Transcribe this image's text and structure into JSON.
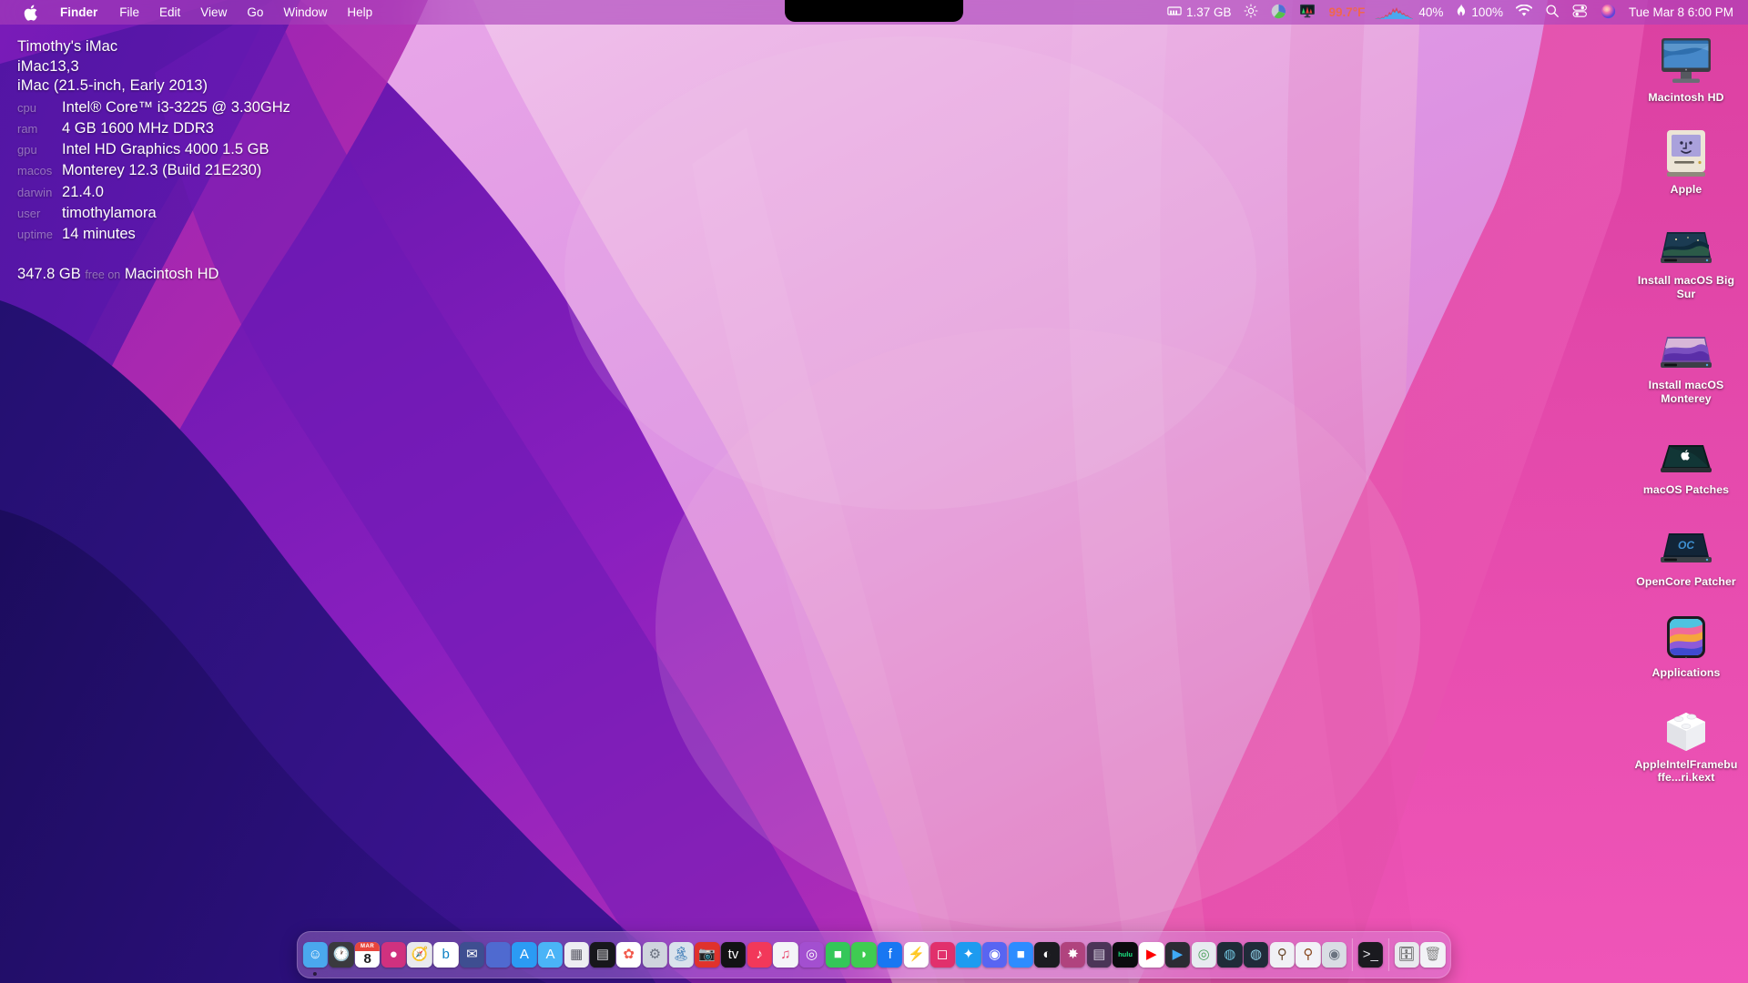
{
  "menubar": {
    "apple_icon": "apple-logo-icon",
    "items": [
      {
        "label": "Finder",
        "bold": true
      },
      {
        "label": "File",
        "bold": false
      },
      {
        "label": "Edit",
        "bold": false
      },
      {
        "label": "View",
        "bold": false
      },
      {
        "label": "Go",
        "bold": false
      },
      {
        "label": "Window",
        "bold": false
      },
      {
        "label": "Help",
        "bold": false
      }
    ],
    "status": {
      "memory_icon": "memory-chip-icon",
      "memory_value": "1.37 GB",
      "brightness_icon": "brightness-sun-icon",
      "disk_pie_icon": "disk-usage-pie-icon",
      "monitor_icon": "display-monitor-icon",
      "temperature_value": "99.7°F",
      "temperature_color": "#f0664f",
      "cpu_graph_icon": "cpu-history-graph-icon",
      "cpu_value": "40%",
      "fan_icon": "fan-flame-icon",
      "fan_value": "100%",
      "wifi_icon": "wifi-icon",
      "search_icon": "spotlight-search-icon",
      "control_center_icon": "control-center-icon",
      "siri_icon": "siri-icon",
      "clock": "Tue Mar 8  6:00 PM"
    }
  },
  "sysinfo": {
    "machine_name": "Timothy's iMac",
    "model_id": "iMac13,3",
    "model_name": "iMac (21.5-inch, Early 2013)",
    "rows": [
      {
        "key": "cpu",
        "value": "Intel® Core™ i3-3225 @ 3.30GHz"
      },
      {
        "key": "ram",
        "value": "4 GB 1600 MHz DDR3"
      },
      {
        "key": "gpu",
        "value": "Intel HD Graphics 4000 1.5 GB"
      },
      {
        "key": "macos",
        "value": "Monterey 12.3 (Build 21E230)"
      },
      {
        "key": "darwin",
        "value": "21.4.0"
      },
      {
        "key": "user",
        "value": "timothylamora"
      },
      {
        "key": "uptime",
        "value": "14 minutes"
      }
    ],
    "disk_free": "347.8 GB",
    "disk_mid": "free on",
    "disk_volume": "Macintosh HD"
  },
  "desktop_icons": [
    {
      "label": "Macintosh HD",
      "icon": "imac-drive-icon"
    },
    {
      "label": "Apple",
      "icon": "classic-mac-folder-icon"
    },
    {
      "label": "Install macOS Big Sur",
      "icon": "bigsur-installer-disk-icon"
    },
    {
      "label": "Install macOS Monterey",
      "icon": "monterey-installer-disk-icon"
    },
    {
      "label": "macOS Patches",
      "icon": "apple-dark-disk-icon"
    },
    {
      "label": "OpenCore Patcher",
      "icon": "opencore-disk-icon"
    },
    {
      "label": "Applications",
      "icon": "applications-folder-icon"
    },
    {
      "label": "AppleIntelFramebuffe...ri.kext",
      "icon": "kext-brick-icon"
    }
  ],
  "dock": {
    "left": [
      {
        "name": "finder",
        "glyph": "☺",
        "bg": "#4aa8ee",
        "fg": "#ffffff",
        "running": true
      },
      {
        "name": "clock",
        "glyph": "🕐",
        "bg": "#3a3a3e",
        "fg": "#ffffff",
        "running": false
      },
      {
        "name": "calendar",
        "glyph": "8",
        "bg": "#ffffff",
        "fg": "#1d1d1f",
        "running": false,
        "badge": "MAR"
      },
      {
        "name": "siri",
        "glyph": "●",
        "bg": "#d0317f",
        "fg": "#ffffff",
        "running": false
      },
      {
        "name": "safari",
        "glyph": "🧭",
        "bg": "#e9e9ee",
        "fg": "#2d6fd6",
        "running": false
      },
      {
        "name": "bing",
        "glyph": "b",
        "bg": "#ffffff",
        "fg": "#0c80c4",
        "running": false
      },
      {
        "name": "mail",
        "glyph": "✉",
        "bg": "#3e4e91",
        "fg": "#ffffff",
        "running": false
      },
      {
        "name": "apple-music-app",
        "glyph": "",
        "bg": "#4f6ad0",
        "fg": "#ffffff",
        "running": false
      },
      {
        "name": "app-store",
        "glyph": "A",
        "bg": "#2b9bf4",
        "fg": "#ffffff",
        "running": false
      },
      {
        "name": "app-store-alt",
        "glyph": "A",
        "bg": "#4ab4f7",
        "fg": "#ffffff",
        "running": false
      },
      {
        "name": "launchpad",
        "glyph": "▦",
        "bg": "#ededf2",
        "fg": "#5a5a66",
        "running": false
      },
      {
        "name": "mission-control",
        "glyph": "▤",
        "bg": "#17171c",
        "fg": "#d8d8dd",
        "running": false
      },
      {
        "name": "photos",
        "glyph": "✿",
        "bg": "#ffffff",
        "fg": "#f25a4c",
        "running": false
      },
      {
        "name": "system-prefs",
        "glyph": "⚙",
        "bg": "#cfd4dd",
        "fg": "#6b7280",
        "running": false
      },
      {
        "name": "preview",
        "glyph": "🏝",
        "bg": "#d9e2ec",
        "fg": "#2a6fb0",
        "running": false
      },
      {
        "name": "photo-booth",
        "glyph": "📷",
        "bg": "#e0322c",
        "fg": "#ffffff",
        "running": false
      },
      {
        "name": "apple-tv",
        "glyph": "tv",
        "bg": "#121214",
        "fg": "#ffffff",
        "running": false
      },
      {
        "name": "music",
        "glyph": "♪",
        "bg": "#f2385a",
        "fg": "#ffffff",
        "running": false
      },
      {
        "name": "itunes",
        "glyph": "♫",
        "bg": "#f4f4f8",
        "fg": "#e8436a",
        "running": false
      },
      {
        "name": "podcasts",
        "glyph": "◎",
        "bg": "#a34fd0",
        "fg": "#ffffff",
        "running": false
      },
      {
        "name": "facetime",
        "glyph": "■",
        "bg": "#34c759",
        "fg": "#ffffff",
        "running": false
      },
      {
        "name": "messages",
        "glyph": "◗",
        "bg": "#3fcc52",
        "fg": "#ffffff",
        "running": false
      },
      {
        "name": "facebook",
        "glyph": "f",
        "bg": "#1877f2",
        "fg": "#ffffff",
        "running": false
      },
      {
        "name": "messenger",
        "glyph": "⚡",
        "bg": "#ffffff",
        "fg": "#1a7af8",
        "running": false
      },
      {
        "name": "instagram",
        "glyph": "◻",
        "bg": "#e1306c",
        "fg": "#ffffff",
        "running": false
      },
      {
        "name": "twitter",
        "glyph": "✦",
        "bg": "#1d9bf0",
        "fg": "#ffffff",
        "running": false
      },
      {
        "name": "discord",
        "glyph": "◉",
        "bg": "#5865f2",
        "fg": "#ffffff",
        "running": false
      },
      {
        "name": "zoom",
        "glyph": "■",
        "bg": "#2d8cff",
        "fg": "#ffffff",
        "running": false
      },
      {
        "name": "github",
        "glyph": "◐",
        "bg": "#1b1b20",
        "fg": "#ffffff",
        "running": false
      },
      {
        "name": "hackintool",
        "glyph": "✸",
        "bg": "#b0437e",
        "fg": "#ffffff",
        "running": false
      },
      {
        "name": "terminal-tool",
        "glyph": "▤",
        "bg": "#4b3557",
        "fg": "#cfc8d8",
        "running": false
      },
      {
        "name": "hulu",
        "glyph": "hulu",
        "bg": "#0b0b0e",
        "fg": "#1ce783",
        "running": false
      },
      {
        "name": "youtube",
        "glyph": "▶",
        "bg": "#ffffff",
        "fg": "#ff0000",
        "running": false
      },
      {
        "name": "iina",
        "glyph": "▶",
        "bg": "#2b2b33",
        "fg": "#3fa9f5",
        "running": false
      },
      {
        "name": "onyx",
        "glyph": "◎",
        "bg": "#e7eaf0",
        "fg": "#4aa05a",
        "running": false
      },
      {
        "name": "cleaner-one",
        "glyph": "◍",
        "bg": "#1f2b38",
        "fg": "#6fc3dd",
        "running": false
      },
      {
        "name": "disk-tool",
        "glyph": "◍",
        "bg": "#202b39",
        "fg": "#8fd0e6",
        "running": false
      },
      {
        "name": "kext-utility",
        "glyph": "⚲",
        "bg": "#f0f0f5",
        "fg": "#6b4a2e",
        "running": false
      },
      {
        "name": "hackintosh-tool",
        "glyph": "⚲",
        "bg": "#f2f2f7",
        "fg": "#8a4a22",
        "running": false
      },
      {
        "name": "system-info",
        "glyph": "◉",
        "bg": "#d9dde4",
        "fg": "#6a7380",
        "running": false
      }
    ],
    "middle": [
      {
        "name": "terminal",
        "glyph": ">_",
        "bg": "#1a1a1f",
        "fg": "#e4e4e9",
        "running": false
      }
    ],
    "right": [
      {
        "name": "downloads-stack",
        "glyph": "🗄",
        "bg": "#e9e9ee",
        "fg": "#333",
        "running": false
      },
      {
        "name": "trash",
        "glyph": "🗑",
        "bg": "#f2f2f6",
        "fg": "#888",
        "running": false
      }
    ]
  }
}
